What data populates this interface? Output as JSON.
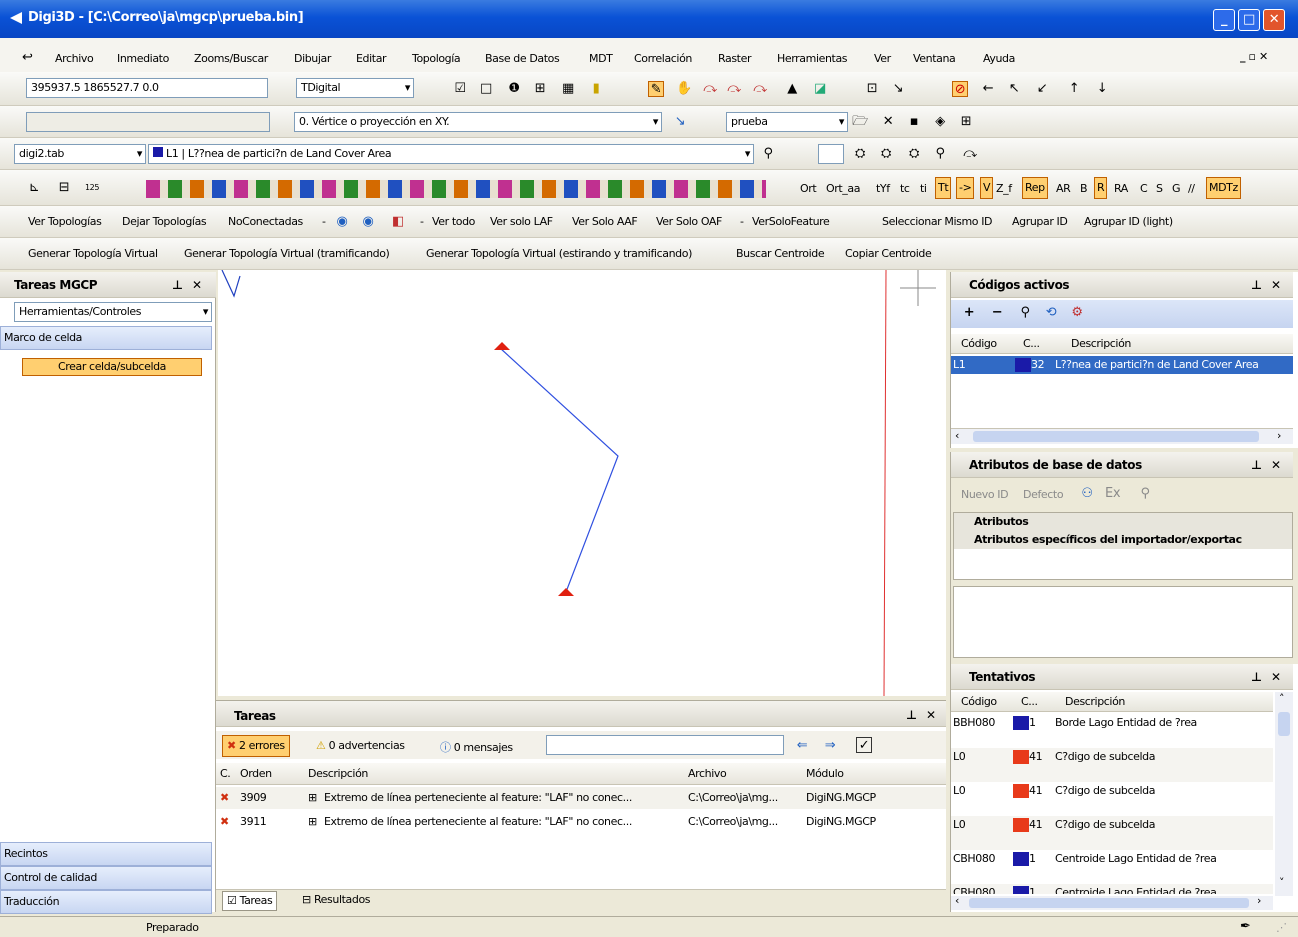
{
  "window": {
    "title": "Digi3D - [C:\\Correo\\ja\\mgcp\\prueba.bin]"
  },
  "menu": [
    "Archivo",
    "Inmediato",
    "Zooms/Buscar",
    "Dibujar",
    "Editar",
    "Topología",
    "Base de Datos",
    "MDT",
    "Correlación",
    "Raster",
    "Herramientas",
    "Ver",
    "Ventana",
    "Ayuda"
  ],
  "toolbar1": {
    "coords": "395937.5 1865527.7  0.0",
    "device": "TDigital"
  },
  "toolbar2": {
    "mode": "0. Vértice o proyección en XY.",
    "file": "prueba"
  },
  "toolbar3": {
    "tabfile": "digi2.tab",
    "code": "L1 | L??nea de partici?n de Land Cover Area"
  },
  "toolbar4": {
    "labels": [
      "Ort",
      "Ort_aa",
      "tYf",
      "tc",
      "ti",
      "Tt",
      "->",
      "V",
      "Z_f",
      "Rep",
      "AR",
      "B",
      "R",
      "RA",
      "C",
      "S",
      "G",
      "//",
      "MDTz"
    ]
  },
  "toolbar5": {
    "items": [
      "Ver Topologías",
      "Dejar Topologías",
      "NoConectadas",
      "-",
      "Ver todo",
      "Ver solo LAF",
      "Ver Solo AAF",
      "Ver Solo OAF",
      "-",
      "VerSoloFeature",
      "Seleccionar Mismo ID",
      "Agrupar ID",
      "Agrupar ID (light)"
    ]
  },
  "toolbar6": {
    "items": [
      "Generar Topología Virtual",
      "Generar Topología Virtual (tramificando)",
      "Generar Topología Virtual (estirando y tramificando)",
      "Buscar Centroide",
      "Copiar Centroide"
    ]
  },
  "left_panel": {
    "title": "Tareas MGCP",
    "dropdown": "Herramientas/Controles",
    "section": "Marco de celda",
    "button": "Crear celda/subcelda",
    "bottom_sections": [
      "Recintos",
      "Control de calidad",
      "Traducción"
    ]
  },
  "tasks": {
    "title": "Tareas",
    "errors": "2 errores",
    "warnings": "0 advertencias",
    "messages": "0 mensajes",
    "columns": [
      "C.",
      "Orden",
      "Descripción",
      "Archivo",
      "Módulo"
    ],
    "rows": [
      {
        "order": "3909",
        "desc": "Extremo de línea perteneciente al feature: \"LAF\" no conec...",
        "file": "C:\\Correo\\ja\\mg...",
        "module": "DigiNG.MGCP"
      },
      {
        "order": "3911",
        "desc": "Extremo de línea perteneciente al feature: \"LAF\" no conec...",
        "file": "C:\\Correo\\ja\\mg...",
        "module": "DigiNG.MGCP"
      }
    ],
    "tabs": [
      "Tareas",
      "Resultados"
    ]
  },
  "codigos_activos": {
    "title": "Códigos activos",
    "columns": [
      "Código",
      "C...",
      "Descripción"
    ],
    "rows": [
      {
        "code": "L1",
        "color": "32",
        "desc": "L??nea de partici?n de Land Cover Area"
      }
    ]
  },
  "atributos": {
    "title": "Atributos de base de datos",
    "buttons": [
      "Nuevo ID",
      "Defecto",
      "Ex"
    ],
    "rows": [
      "Atributos",
      "Atributos específicos del importador/exportac"
    ]
  },
  "tentativos": {
    "title": "Tentativos",
    "columns": [
      "Código",
      "C...",
      "Descripción"
    ],
    "rows": [
      {
        "code": "BBH080",
        "color": "1",
        "desc": "Borde Lago Entidad de ?rea",
        "hex": "#1a1aa8"
      },
      {
        "code": "L0",
        "color": "41",
        "desc": "C?digo de subcelda",
        "hex": "#e83a1a"
      },
      {
        "code": "L0",
        "color": "41",
        "desc": "C?digo de subcelda",
        "hex": "#e83a1a"
      },
      {
        "code": "L0",
        "color": "41",
        "desc": "C?digo de subcelda",
        "hex": "#e83a1a"
      },
      {
        "code": "CBH080",
        "color": "1",
        "desc": "Centroide Lago Entidad de ?rea",
        "hex": "#1a1aa8"
      },
      {
        "code": "CBH080",
        "color": "1",
        "desc": "Centroide Lago Entidad de ?rea",
        "hex": "#1a1aa8"
      }
    ]
  },
  "status": {
    "text": "Preparado"
  }
}
